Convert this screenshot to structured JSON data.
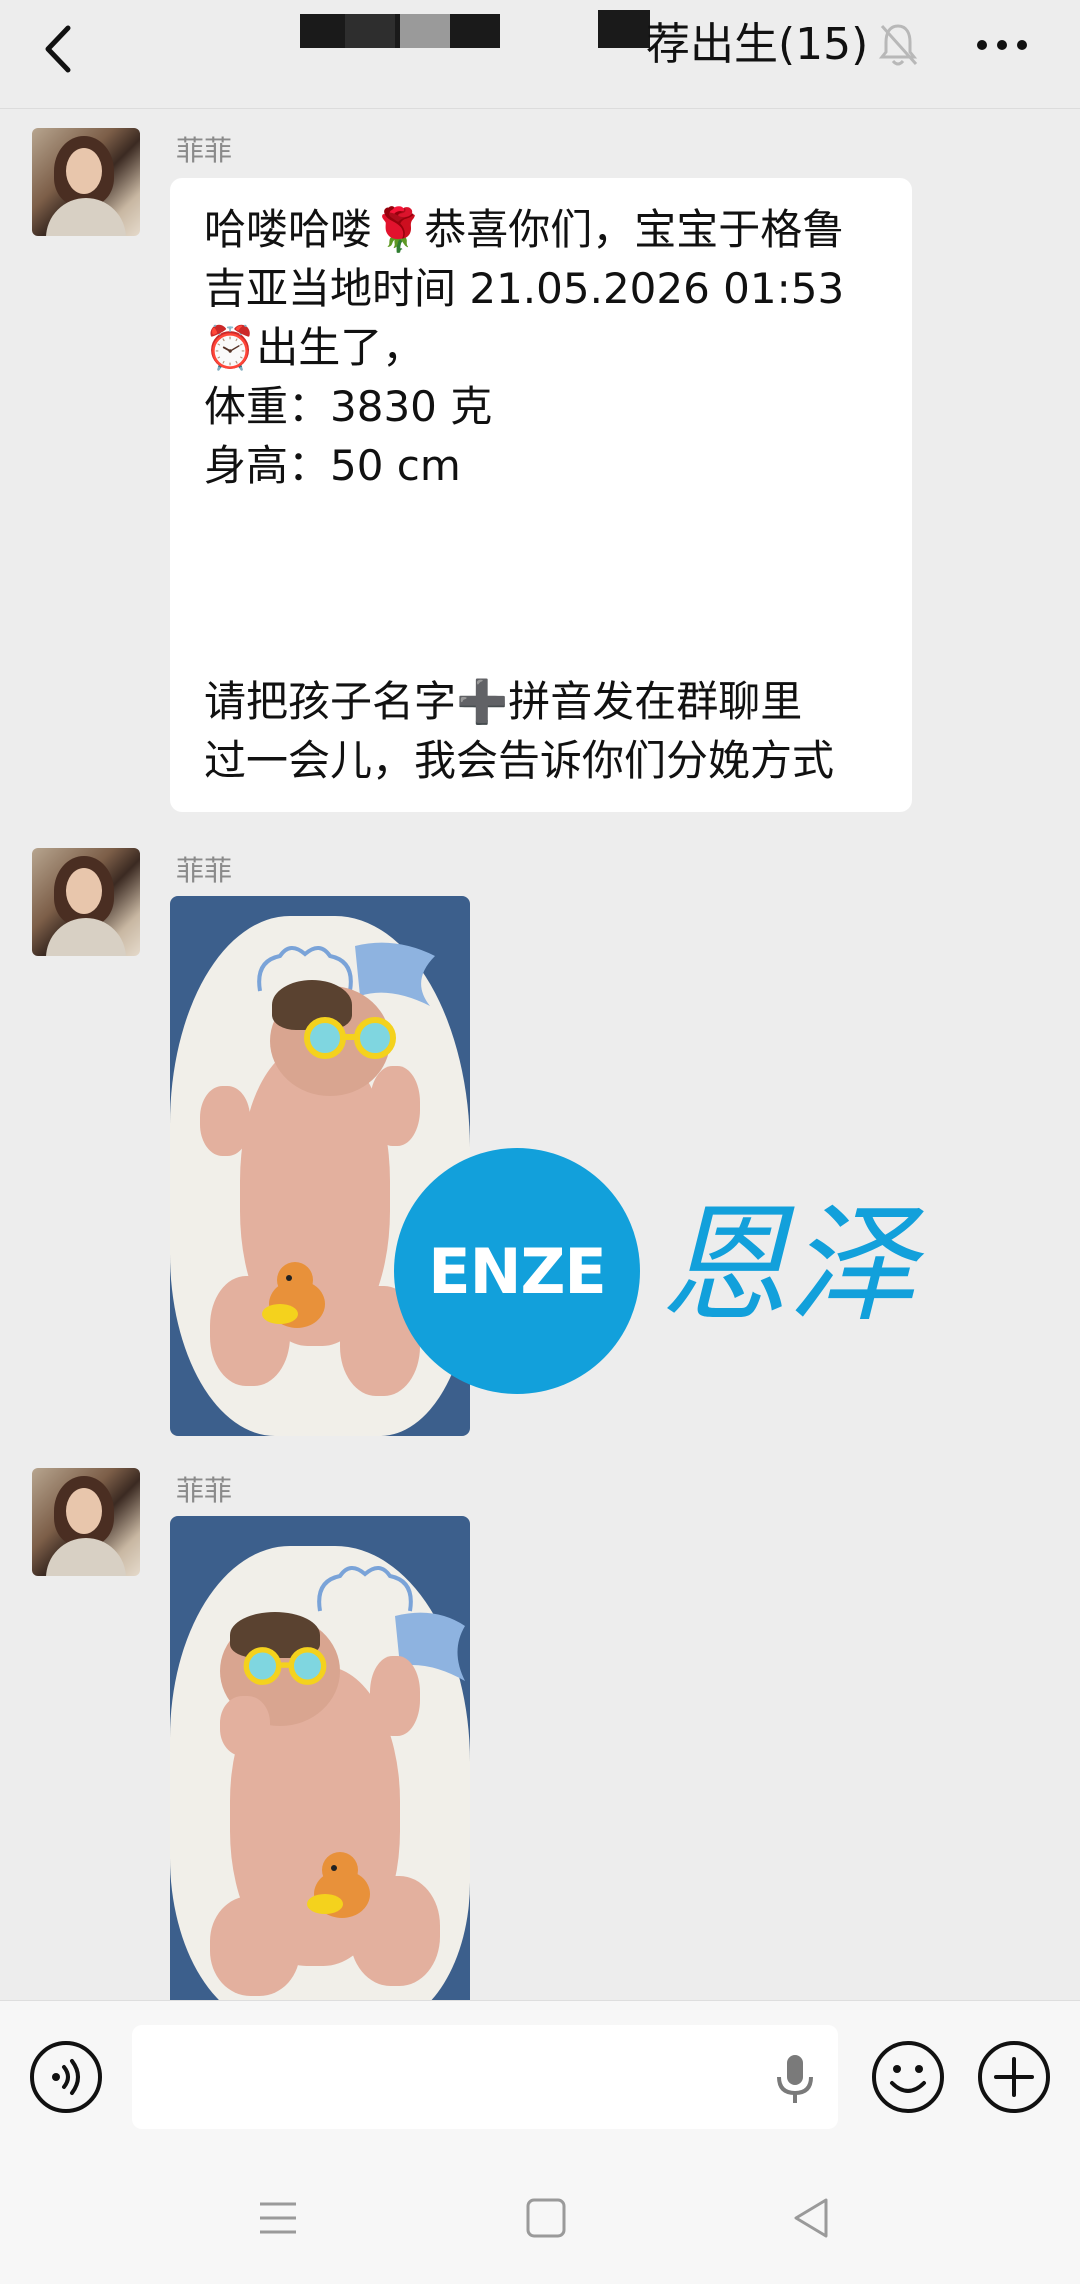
{
  "header": {
    "title": "荐出生(15)",
    "back_icon": "chevron-left-icon",
    "mute_icon": "bell-off-icon",
    "more_icon": "ellipsis-icon"
  },
  "messages": [
    {
      "sender": "菲菲",
      "type": "text",
      "lines": [
        "哈喽哈喽🌹恭喜你们，宝宝于格鲁",
        "吉亚当地时间 21.05.2026 01:53",
        "⏰出生了，",
        "体重：3830 克",
        "身高：50 cm",
        "",
        "请把孩子名字➕拼音发在群聊里",
        "过一会儿，我会告诉你们分娩方式"
      ]
    },
    {
      "sender": "菲菲",
      "type": "image"
    },
    {
      "sender": "菲菲",
      "type": "image"
    }
  ],
  "watermark": {
    "badge": "ENZE",
    "text": "恩泽"
  },
  "input_bar": {
    "voice_icon": "voice-icon",
    "placeholder": "",
    "mic_icon": "microphone-icon",
    "emoji_icon": "smiley-icon",
    "plus_icon": "plus-icon"
  },
  "colors": {
    "background": "#ededed",
    "watermark": "#12a0db",
    "bubble": "#ffffff"
  }
}
